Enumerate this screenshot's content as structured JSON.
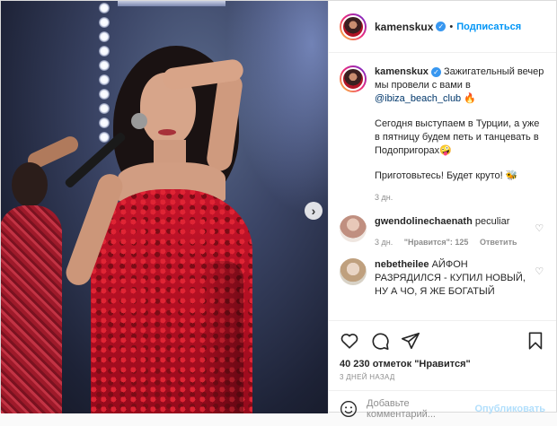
{
  "post": {
    "author": "kamenskux",
    "follow_label": "Подписаться",
    "caption": {
      "line1": "Зажигательный вечер мы провели с вами в",
      "mention": "@ibiza_beach_club",
      "emoji1": "🔥",
      "p2": "Сегодня выступаем в Турции, а уже в пятницу будем петь и танцевать в Подопригорах",
      "emoji2": "🤪",
      "p3": "Приготовьтесь! Будет круто!",
      "emoji3": "🐝",
      "time": "3 дн."
    },
    "comments": [
      {
        "user": "gwendolinechaenath",
        "text": "peculiar",
        "time": "3 дн.",
        "likes_label": "\"Нравится\": 125",
        "reply_label": "Ответить"
      },
      {
        "user": "nebetheilee",
        "text": "АЙФОН РАЗРЯДИЛСЯ - КУПИЛ НОВЫЙ, НУ А ЧО, Я ЖЕ БОГАТЫЙ"
      }
    ],
    "likes_count": "40 230 отметок",
    "likes_link": "\"Нравится\"",
    "date": "3 ДНЕЙ НАЗАД",
    "comment_placeholder": "Добавьте комментарий...",
    "publish_label": "Опубликовать"
  },
  "icons": {
    "heart": "heart-icon",
    "comment": "comment-icon",
    "share": "share-icon",
    "bookmark": "bookmark-icon",
    "emoji": "smiley-icon",
    "carousel_next": "chevron-right-icon",
    "verified": "verified-badge-icon"
  },
  "colors": {
    "link": "#0095f6",
    "mention": "#00376b",
    "muted": "#8e8e8e",
    "publish_disabled": "#b2dffc",
    "dress": "#c4142a"
  }
}
